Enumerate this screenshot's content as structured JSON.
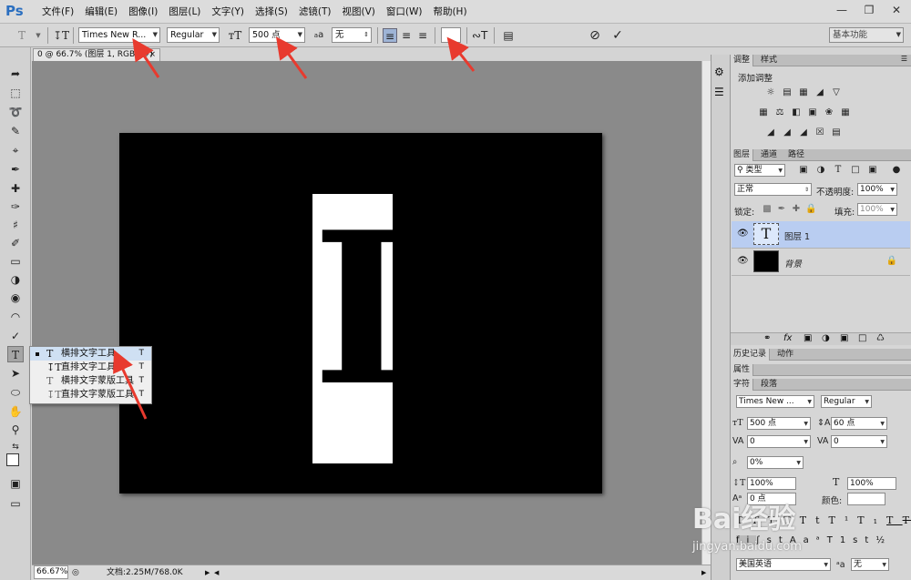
{
  "app": {
    "logo": "Ps"
  },
  "menu": [
    "文件(F)",
    "编辑(E)",
    "图像(I)",
    "图层(L)",
    "文字(Y)",
    "选择(S)",
    "滤镜(T)",
    "视图(V)",
    "窗口(W)",
    "帮助(H)"
  ],
  "options": {
    "font_family": "Times New R...",
    "font_style": "Regular",
    "font_size": "500 点",
    "aa_label": "a",
    "aa_method": "无",
    "workspace": "基本功能"
  },
  "document": {
    "tab_title": "0 @ 66.7% (图层 1, RGB/8#)",
    "big_letter": "I"
  },
  "status": {
    "zoom": "66.67%",
    "doc_info": "文档:2.25M/768.0K"
  },
  "flyout": {
    "items": [
      {
        "label": "横排文字工具",
        "key": "T"
      },
      {
        "label": "直排文字工具",
        "key": "T"
      },
      {
        "label": "横排文字蒙版工具",
        "key": "T"
      },
      {
        "label": "直排文字蒙版工具",
        "key": "T"
      }
    ]
  },
  "adjustments": {
    "tabs": [
      "调整",
      "样式"
    ],
    "title": "添加调整"
  },
  "layers": {
    "tabs": [
      "图层",
      "通道",
      "路径"
    ],
    "filter": "类型",
    "blend_mode": "正常",
    "opacity_label": "不透明度:",
    "opacity": "100%",
    "lock_label": "锁定:",
    "fill_label": "填充:",
    "fill": "100%",
    "rows": [
      {
        "name": "图层 1",
        "thumb_glyph": "T"
      },
      {
        "name": "背景"
      }
    ]
  },
  "history": {
    "tabs": [
      "历史记录",
      "动作"
    ]
  },
  "properties": {
    "label": "属性"
  },
  "character": {
    "tabs": [
      "字符",
      "段落"
    ],
    "font_family": "Times New ...",
    "font_style": "Regular",
    "size": "500 点",
    "leading": "60 点",
    "kerning": "0",
    "tracking": "0",
    "scale_pct": "0%",
    "vscale": "100%",
    "hscale": "100%",
    "baseline": "0 点",
    "color_label": "颜色:",
    "language": "美国英语",
    "aa_method": "无"
  },
  "watermark": {
    "line1": "Bai经验",
    "line2": "jingyan.baidu.com"
  },
  "colors": {
    "accent_blue": "#2b6fc0",
    "arrow_red": "#e83a2e",
    "selected_layer": "#b9cdf1"
  }
}
